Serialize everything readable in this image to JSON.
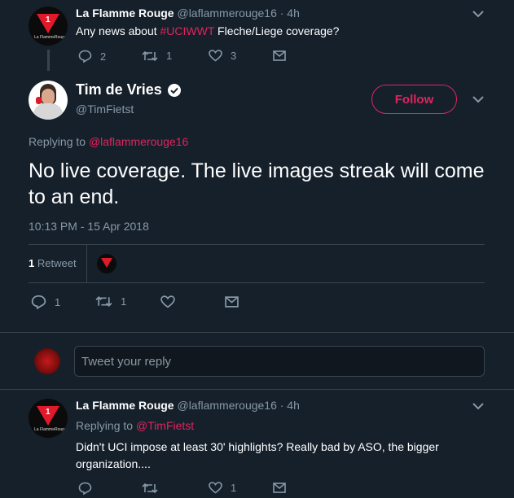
{
  "colors": {
    "background": "#15202b",
    "accent": "#e0245e",
    "muted": "#8899a6",
    "divider": "#38444d"
  },
  "parent_tweet": {
    "display_name": "La Flamme Rouge",
    "handle_time": "@laflammerouge16 · 4h",
    "text_before": "Any news about ",
    "hashtag": "#UCIWWT",
    "text_after": " Fleche/Liege coverage?",
    "replies": "2",
    "retweets": "1",
    "likes": "3",
    "avatar_brand": "La FlammeRouge",
    "avatar_mark": "1"
  },
  "main_tweet": {
    "display_name": "Tim de Vries",
    "handle": "@TimFietst",
    "follow_label": "Follow",
    "replying_to_label": "Replying to",
    "replying_to_handle": "@laflammerouge16",
    "text": "No live coverage. The live images streak will come to an end.",
    "timestamp": "10:13 PM - 15 Apr 2018",
    "retweet_count": "1",
    "retweet_label": "Retweet",
    "replies": "1",
    "retweets": "1"
  },
  "compose": {
    "placeholder": "Tweet your reply"
  },
  "reply_tweet": {
    "display_name": "La Flamme Rouge",
    "handle_time": "@laflammerouge16 · 4h",
    "replying_to_label": "Replying to",
    "replying_to_handle": "@TimFietst",
    "text": "Didn't UCI impose at least 30' highlights? Really bad by ASO, the bigger organization....",
    "likes": "1",
    "avatar_brand": "La FlammeRouge",
    "avatar_mark": "1"
  },
  "icons": [
    "reply-icon",
    "retweet-icon",
    "heart-icon",
    "message-icon",
    "chevron-down-icon",
    "verified-icon"
  ]
}
